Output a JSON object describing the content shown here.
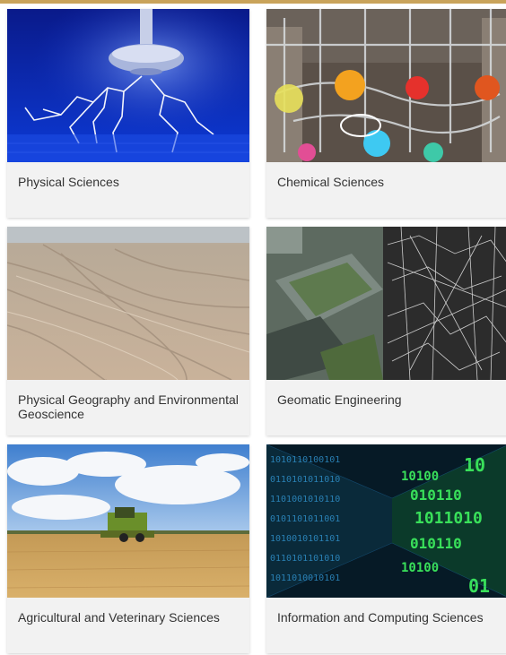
{
  "cards": [
    {
      "label": "Physical Sciences",
      "image": "lightning-tesla-coil"
    },
    {
      "label": "Chemical Sciences",
      "image": "laboratory-glassware"
    },
    {
      "label": "Physical Geography and Environmental Geoscience",
      "image": "aerial-desert-landscape"
    },
    {
      "label": "Geomatic Engineering",
      "image": "aerial-city-wireframe"
    },
    {
      "label": "Agricultural and Veterinary Sciences",
      "image": "combine-harvester-field"
    },
    {
      "label": "Information and Computing Sciences",
      "image": "binary-code-tunnel"
    }
  ]
}
